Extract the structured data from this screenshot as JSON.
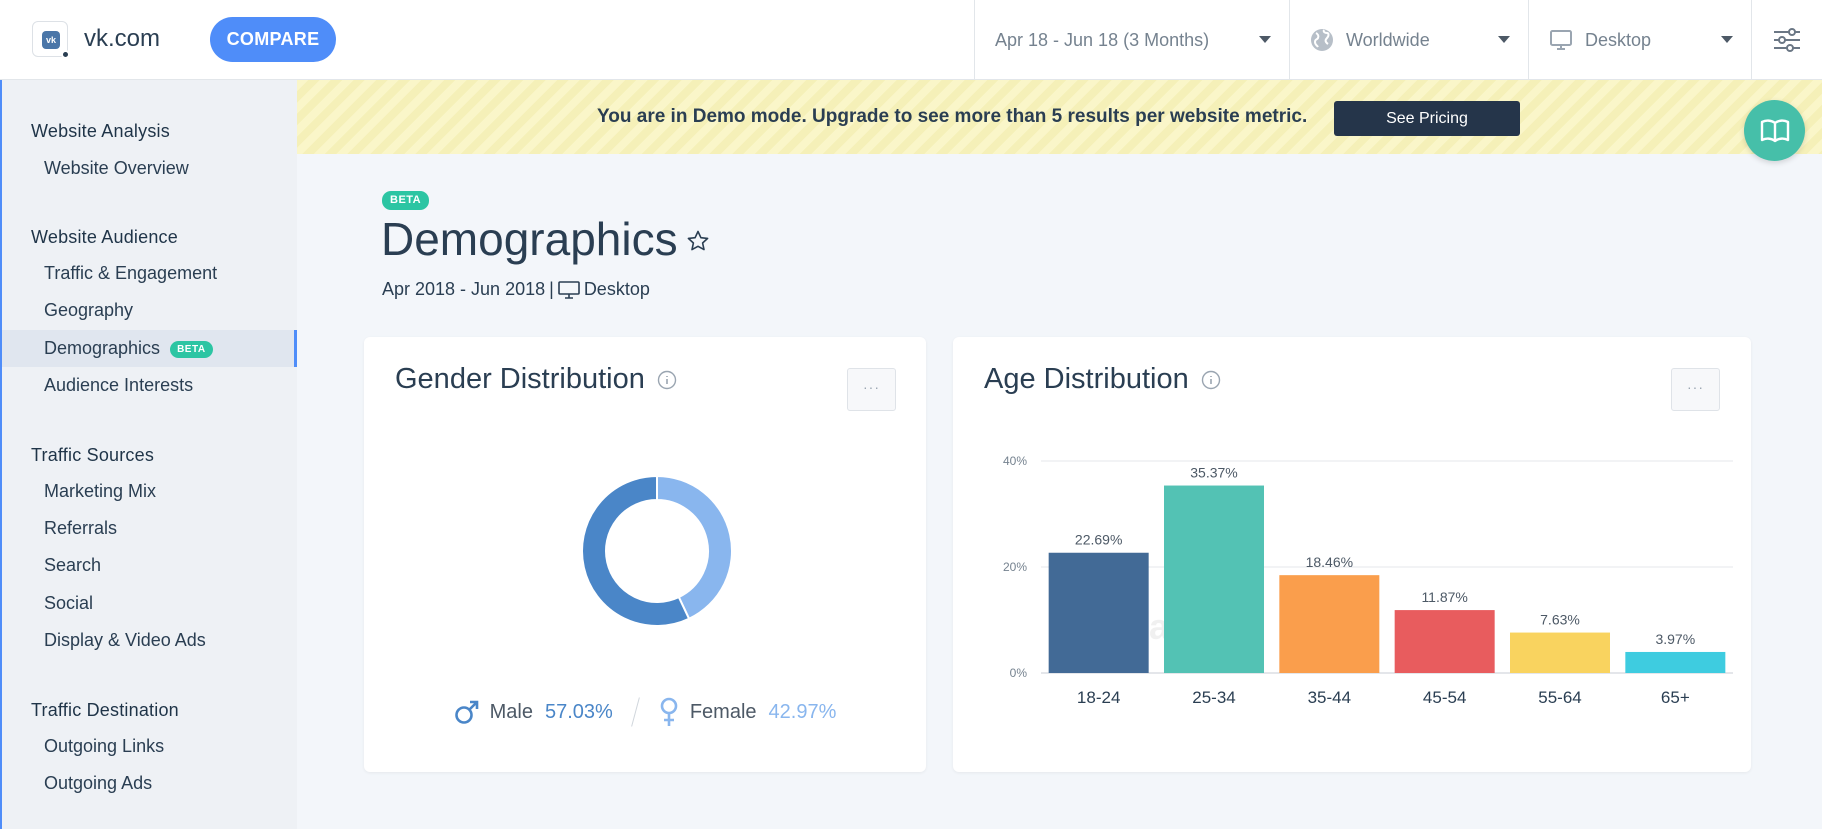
{
  "header": {
    "site": "vk.com",
    "compare_label": "COMPARE",
    "date_filter": "Apr 18 - Jun 18 (3 Months)",
    "geo_filter": "Worldwide",
    "device_filter": "Desktop"
  },
  "sidebar": {
    "sections": [
      {
        "title": "Website Analysis",
        "items": [
          "Website Overview"
        ]
      },
      {
        "title": "Website Audience",
        "items": [
          "Traffic & Engagement",
          "Geography",
          "Demographics",
          "Audience Interests"
        ]
      },
      {
        "title": "Traffic Sources",
        "items": [
          "Marketing Mix",
          "Referrals",
          "Search",
          "Social",
          "Display & Video Ads"
        ]
      },
      {
        "title": "Traffic Destination",
        "items": [
          "Outgoing Links",
          "Outgoing Ads"
        ]
      }
    ],
    "active_item": "Demographics",
    "beta_label": "BETA"
  },
  "banner": {
    "text": "You are in Demo mode. Upgrade to see more than 5 results per website metric.",
    "button": "See Pricing"
  },
  "page": {
    "beta_label": "BETA",
    "title": "Demographics",
    "date_range": "Apr 2018 - Jun 2018",
    "separator": "|",
    "device": "Desktop"
  },
  "gender_card": {
    "title": "Gender Distribution",
    "more_label": "···",
    "male_label": "Male",
    "male_value": "57.03%",
    "female_label": "Female",
    "female_value": "42.97%",
    "colors": {
      "male": "#4a86c8",
      "female": "#89b6ee"
    }
  },
  "age_card": {
    "title": "Age Distribution",
    "more_label": "···",
    "watermark": "SimilarWeb"
  },
  "chart_data": [
    {
      "type": "pie",
      "title": "Gender Distribution",
      "categories": [
        "Male",
        "Female"
      ],
      "values": [
        57.03,
        42.97
      ],
      "colors": [
        "#4a86c8",
        "#89b6ee"
      ]
    },
    {
      "type": "bar",
      "title": "Age Distribution",
      "categories": [
        "18-24",
        "25-34",
        "35-44",
        "45-54",
        "55-64",
        "65+"
      ],
      "values": [
        22.69,
        35.37,
        18.46,
        11.87,
        7.63,
        3.97
      ],
      "labels": [
        "22.69%",
        "35.37%",
        "18.46%",
        "11.87%",
        "7.63%",
        "3.97%"
      ],
      "colors": [
        "#426a96",
        "#53c2b4",
        "#fa9e4c",
        "#e85c5e",
        "#f9d35f",
        "#3ecce0"
      ],
      "yticks": [
        "0%",
        "20%",
        "40%"
      ],
      "ylim": [
        0,
        40
      ],
      "grid": true
    }
  ]
}
